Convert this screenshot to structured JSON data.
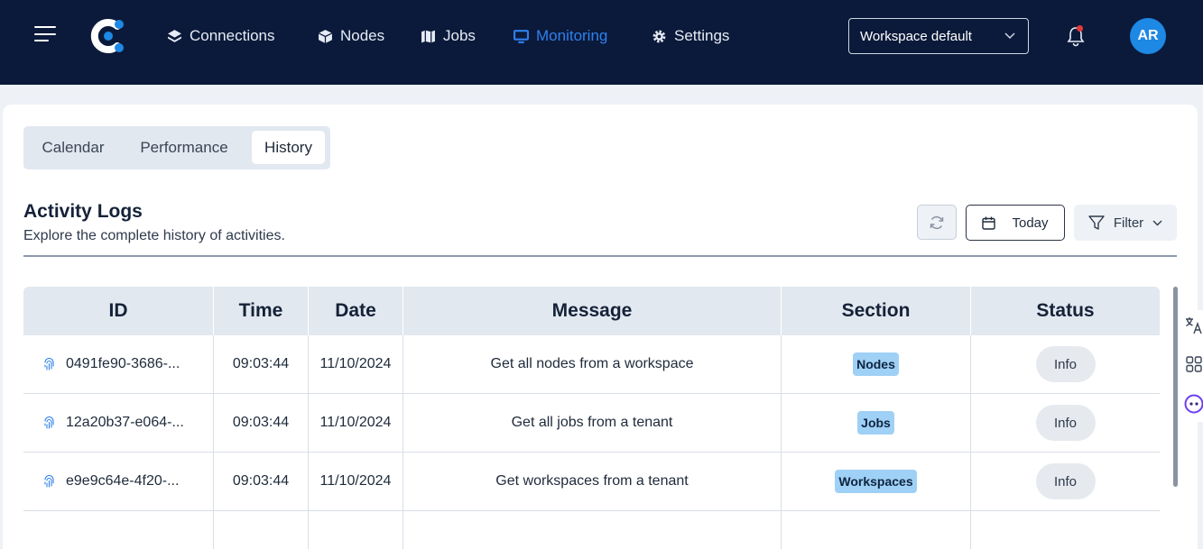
{
  "nav": {
    "items": [
      {
        "label": "Connections",
        "icon": "layers-icon"
      },
      {
        "label": "Nodes",
        "icon": "cube-icon"
      },
      {
        "label": "Jobs",
        "icon": "map-icon"
      },
      {
        "label": "Monitoring",
        "icon": "monitor-icon",
        "active": true
      },
      {
        "label": "Settings",
        "icon": "gear-icon"
      }
    ],
    "workspace_select": "Workspace default",
    "avatar_initials": "AR",
    "accent_color": "#2f80ed",
    "bar_color": "#0b1a3a"
  },
  "tabs": [
    "Calendar",
    "Performance",
    "History"
  ],
  "active_tab": "History",
  "section": {
    "title": "Activity Logs",
    "subtitle": "Explore the complete history of activities.",
    "today_label": "Today",
    "filter_label": "Filter"
  },
  "table": {
    "headers": [
      "ID",
      "Time",
      "Date",
      "Message",
      "Section",
      "Status"
    ],
    "rows": [
      {
        "id": "0491fe90-3686-...",
        "time": "09:03:44",
        "date": "11/10/2024",
        "message": "Get all nodes from a workspace",
        "section": "Nodes",
        "status": "Info"
      },
      {
        "id": "12a20b37-e064-...",
        "time": "09:03:44",
        "date": "11/10/2024",
        "message": "Get all jobs from a tenant",
        "section": "Jobs",
        "status": "Info"
      },
      {
        "id": "e9e9c64e-4f20-...",
        "time": "09:03:44",
        "date": "11/10/2024",
        "message": "Get workspaces from a tenant",
        "section": "Workspaces",
        "status": "Info"
      }
    ]
  }
}
